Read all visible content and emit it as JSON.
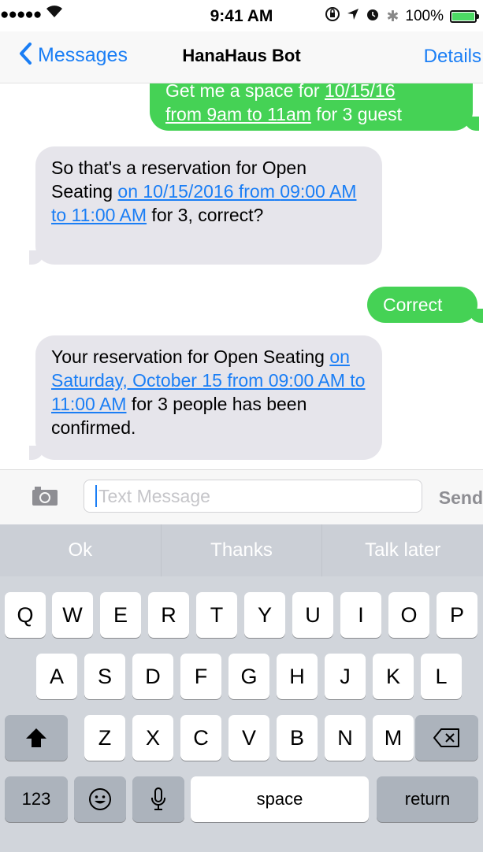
{
  "status_bar": {
    "signal": "●●●●●",
    "time": "9:41 AM",
    "battery": "100%",
    "icons": [
      "wifi-icon",
      "orientation-lock-icon",
      "location-icon",
      "alarm-icon",
      "bluetooth-icon",
      "battery-icon"
    ]
  },
  "nav": {
    "back_label": "Messages",
    "title": "HanaHaus Bot",
    "details_label": "Details"
  },
  "messages": [
    {
      "direction": "outgoing",
      "text_before": "Get me a space for ",
      "link": "10/15/16 from 9am to 11am",
      "link_line1": "10/15/16",
      "link_line2": "from 9am to 11am",
      "text_after": " for 3 guest"
    },
    {
      "direction": "incoming",
      "text_before": "So that's a reservation for Open Seating ",
      "link": "on 10/15/2016 from 09:00 AM to 11:00 AM",
      "link_line1": "on 10/15/2016 from",
      "link_line2": "09:00 AM to 11:00 AM",
      "text_after": " for 3, correct?"
    },
    {
      "direction": "outgoing",
      "text": "Correct"
    },
    {
      "direction": "incoming",
      "text_before": "Your reservation for Open Seating ",
      "link": "on Saturday, October 15 from 09:00 AM to 11:00 AM",
      "link_line1": "on Saturday, October 15",
      "link_line2": "from 09:00 AM to 11:00 AM",
      "text_after": " for 3 people has been confirmed."
    }
  ],
  "input": {
    "placeholder": "Text Message",
    "send_label": "Send"
  },
  "keyboard": {
    "suggestions": [
      "Ok",
      "Thanks",
      "Talk later"
    ],
    "row1": [
      "Q",
      "W",
      "E",
      "R",
      "T",
      "Y",
      "U",
      "I",
      "O",
      "P"
    ],
    "row2": [
      "A",
      "S",
      "D",
      "F",
      "G",
      "H",
      "J",
      "K",
      "L"
    ],
    "row3": [
      "Z",
      "X",
      "C",
      "V",
      "B",
      "N",
      "M"
    ],
    "numbers_label": "123",
    "space_label": "space",
    "return_label": "return"
  },
  "colors": {
    "accent": "#1a7ef5",
    "outgoing_bubble": "#45d255",
    "incoming_bubble": "#e6e5eb",
    "keyboard_bg": "#d1d5db"
  }
}
